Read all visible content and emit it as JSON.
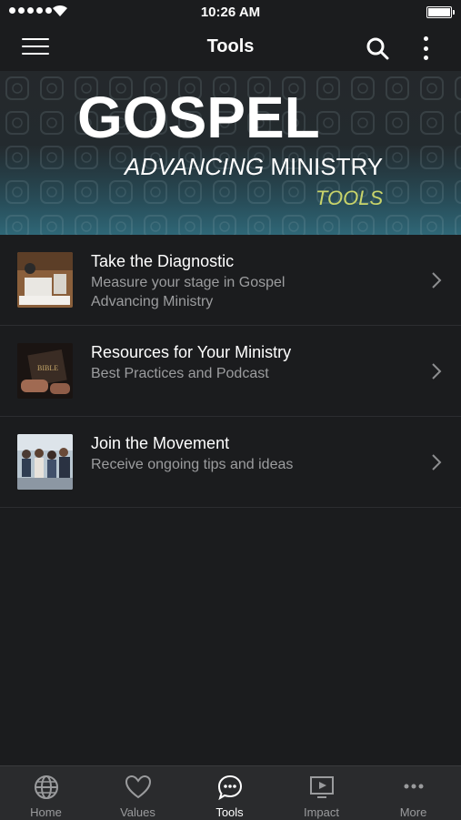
{
  "status_bar": {
    "time": "10:26 AM"
  },
  "nav": {
    "title": "Tools",
    "menu_icon": "hamburger-menu-icon",
    "search_icon": "search-icon",
    "more_icon": "vertical-dots-icon"
  },
  "banner": {
    "line1": "GOSPEL",
    "line2_italic": "ADVANCING",
    "line2_rest": " MINISTRY",
    "line3": "TOOLS",
    "accent_color": "#c9d46a"
  },
  "items": [
    {
      "title": "Take the Diagnostic",
      "subtitle_line1": "Measure your stage in Gospel",
      "subtitle_line2": "Advancing Ministry",
      "thumb": "desk-photo"
    },
    {
      "title": "Resources for Your Ministry",
      "subtitle_line1": "Best Practices and Podcast",
      "subtitle_line2": "",
      "thumb": "bible-photo"
    },
    {
      "title": "Join the Movement",
      "subtitle_line1": "Receive ongoing tips and ideas",
      "subtitle_line2": "",
      "thumb": "group-photo"
    }
  ],
  "tabs": [
    {
      "label": "Home",
      "icon": "globe-icon"
    },
    {
      "label": "Values",
      "icon": "heart-icon"
    },
    {
      "label": "Tools",
      "icon": "chat-bubble-icon",
      "active": true
    },
    {
      "label": "Impact",
      "icon": "play-screen-icon"
    },
    {
      "label": "More",
      "icon": "ellipsis-icon"
    }
  ]
}
